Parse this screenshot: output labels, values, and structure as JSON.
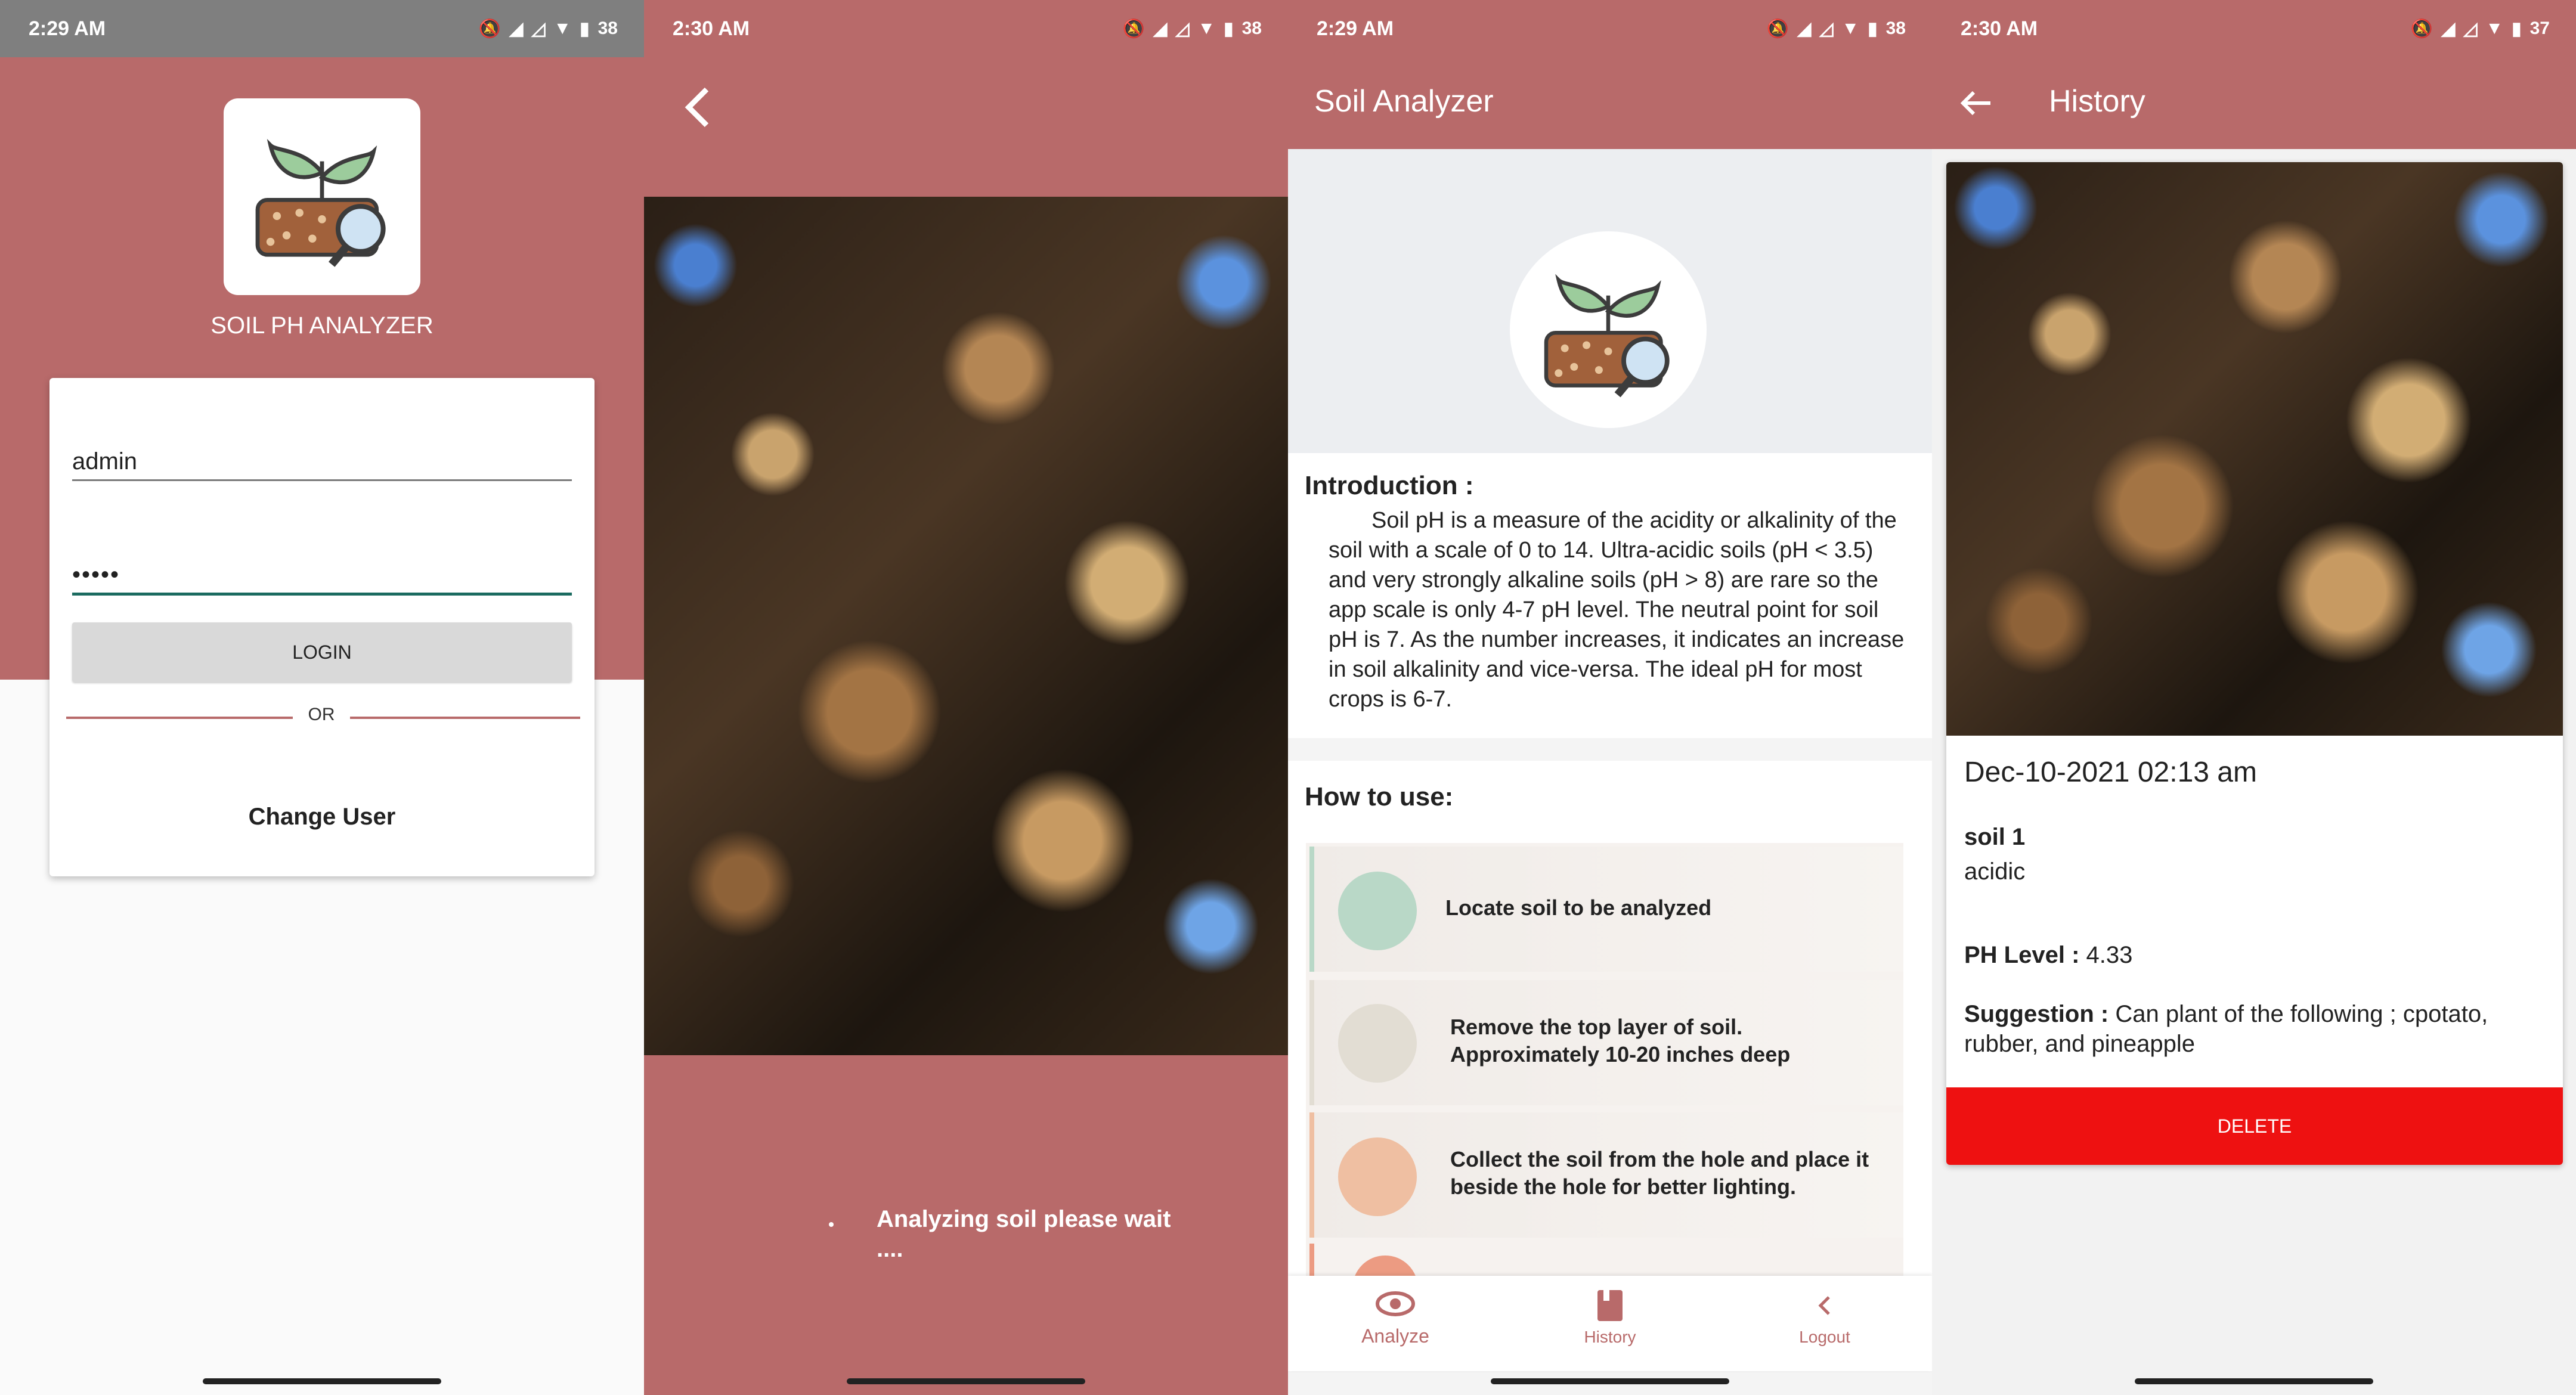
{
  "screen1": {
    "status": {
      "time": "2:29 AM",
      "battery": "38"
    },
    "app_title": "SOIL PH ANALYZER",
    "username_value": "admin",
    "password_value": "•••••",
    "login_label": "LOGIN",
    "or_label": "OR",
    "change_user_label": "Change User"
  },
  "screen2": {
    "status": {
      "time": "2:30 AM",
      "battery": "38"
    },
    "loading_text": "Analyzing soil please wait ...."
  },
  "screen3": {
    "status": {
      "time": "2:29 AM",
      "battery": "38"
    },
    "toolbar_title": "Soil Analyzer",
    "intro_heading": "Introduction :",
    "intro_text": "Soil pH is a measure of the acidity or alkalinity of the soil with a scale of 0 to 14. Ultra-acidic soils (pH < 3.5) and very strongly alkaline soils (pH > 8) are rare so the app scale is only 4-7 pH level. The neutral point for soil pH is 7. As the number increases, it indicates an increase in soil alkalinity and vice-versa. The ideal pH for most crops is 6-7.",
    "howto_heading": "How to use:",
    "steps": [
      {
        "text": "Locate soil to be analyzed",
        "color": "#b9d8c7"
      },
      {
        "text": "Remove the top layer of soil. Approximately 10-20 inches deep",
        "color": "#e2ddd3"
      },
      {
        "text": "Collect the soil from the hole and place it beside the hole for better lighting.",
        "color": "#efbfa2"
      }
    ],
    "nav": [
      {
        "label": "Analyze",
        "icon": "eye-icon"
      },
      {
        "label": "History",
        "icon": "book-icon"
      },
      {
        "label": "Logout",
        "icon": "chevron-left-icon"
      }
    ]
  },
  "screen4": {
    "status": {
      "time": "2:30 AM",
      "battery": "37"
    },
    "toolbar_title": "History",
    "date": "Dec-10-2021 02:13 am",
    "soil_name": "soil 1",
    "soil_type": "acidic",
    "ph_label": "PH Level :",
    "ph_value": "4.33",
    "suggestion_label": "Suggestion :",
    "suggestion_value": "Can plant of the following ; cpotato, rubber, and pineapple",
    "delete_label": "DELETE"
  },
  "colors": {
    "brand": "#b86a6a",
    "delete": "#ee1111",
    "accent_line": "#1b6b60"
  }
}
